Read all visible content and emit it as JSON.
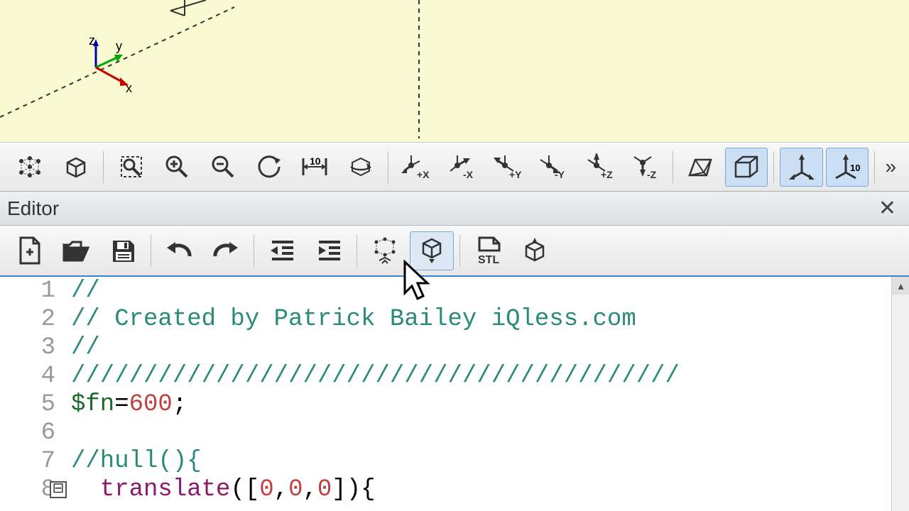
{
  "viewport": {
    "axes": {
      "x_label": "x",
      "y_label": "y",
      "z_label": "z"
    }
  },
  "viewer_toolbar": {
    "items": [
      {
        "name": "preview",
        "label": ""
      },
      {
        "name": "render",
        "label": ""
      },
      {
        "name": "zoom-fit",
        "label": ""
      },
      {
        "name": "zoom-in",
        "label": ""
      },
      {
        "name": "zoom-out",
        "label": ""
      },
      {
        "name": "reset-view",
        "label": ""
      },
      {
        "name": "view-10",
        "label": "10"
      },
      {
        "name": "view-rotate",
        "label": ""
      },
      {
        "name": "axis-plus-x",
        "label": "+X"
      },
      {
        "name": "axis-minus-x",
        "label": "-X"
      },
      {
        "name": "axis-plus-y",
        "label": "+Y"
      },
      {
        "name": "axis-minus-y",
        "label": "-Y"
      },
      {
        "name": "axis-plus-z",
        "label": "+Z"
      },
      {
        "name": "axis-minus-z",
        "label": "-Z"
      },
      {
        "name": "perspective",
        "label": ""
      },
      {
        "name": "orthogonal",
        "label": "",
        "active": true
      },
      {
        "name": "show-axes",
        "label": "",
        "active": true
      },
      {
        "name": "show-scale",
        "label": "10",
        "active": true
      }
    ],
    "more": "»"
  },
  "panel": {
    "title": "Editor",
    "close": "✕"
  },
  "editor_toolbar": {
    "items": [
      {
        "name": "new",
        "label": ""
      },
      {
        "name": "open",
        "label": ""
      },
      {
        "name": "save",
        "label": ""
      },
      {
        "name": "undo",
        "label": ""
      },
      {
        "name": "redo",
        "label": ""
      },
      {
        "name": "unindent",
        "label": ""
      },
      {
        "name": "indent",
        "label": ""
      },
      {
        "name": "preview",
        "label": ""
      },
      {
        "name": "render",
        "label": "",
        "hovered": true
      },
      {
        "name": "export-stl",
        "label": "STL"
      },
      {
        "name": "send-to",
        "label": ""
      }
    ]
  },
  "code": {
    "lines": [
      {
        "num": "1",
        "tokens": [
          {
            "t": "//",
            "c": "comment"
          }
        ]
      },
      {
        "num": "2",
        "tokens": [
          {
            "t": "// Created by Patrick Bailey iQless.com",
            "c": "comment"
          }
        ]
      },
      {
        "num": "3",
        "tokens": [
          {
            "t": "//",
            "c": "comment"
          }
        ]
      },
      {
        "num": "4",
        "tokens": [
          {
            "t": "//////////////////////////////////////////",
            "c": "comment"
          }
        ]
      },
      {
        "num": "5",
        "tokens": [
          {
            "t": "$fn",
            "c": "special"
          },
          {
            "t": "=",
            "c": "black"
          },
          {
            "t": "600",
            "c": "number"
          },
          {
            "t": ";",
            "c": "black"
          }
        ]
      },
      {
        "num": "6",
        "tokens": []
      },
      {
        "num": "7",
        "tokens": [
          {
            "t": "//hull(){",
            "c": "comment"
          }
        ]
      },
      {
        "num": "8",
        "tokens": [
          {
            "t": "  ",
            "c": "black"
          },
          {
            "t": "translate",
            "c": "keyword"
          },
          {
            "t": "([",
            "c": "black"
          },
          {
            "t": "0",
            "c": "number"
          },
          {
            "t": ",",
            "c": "black"
          },
          {
            "t": "0",
            "c": "number"
          },
          {
            "t": ",",
            "c": "black"
          },
          {
            "t": "0",
            "c": "number"
          },
          {
            "t": "]){",
            "c": "black"
          }
        ],
        "fold": "⊟"
      }
    ]
  }
}
